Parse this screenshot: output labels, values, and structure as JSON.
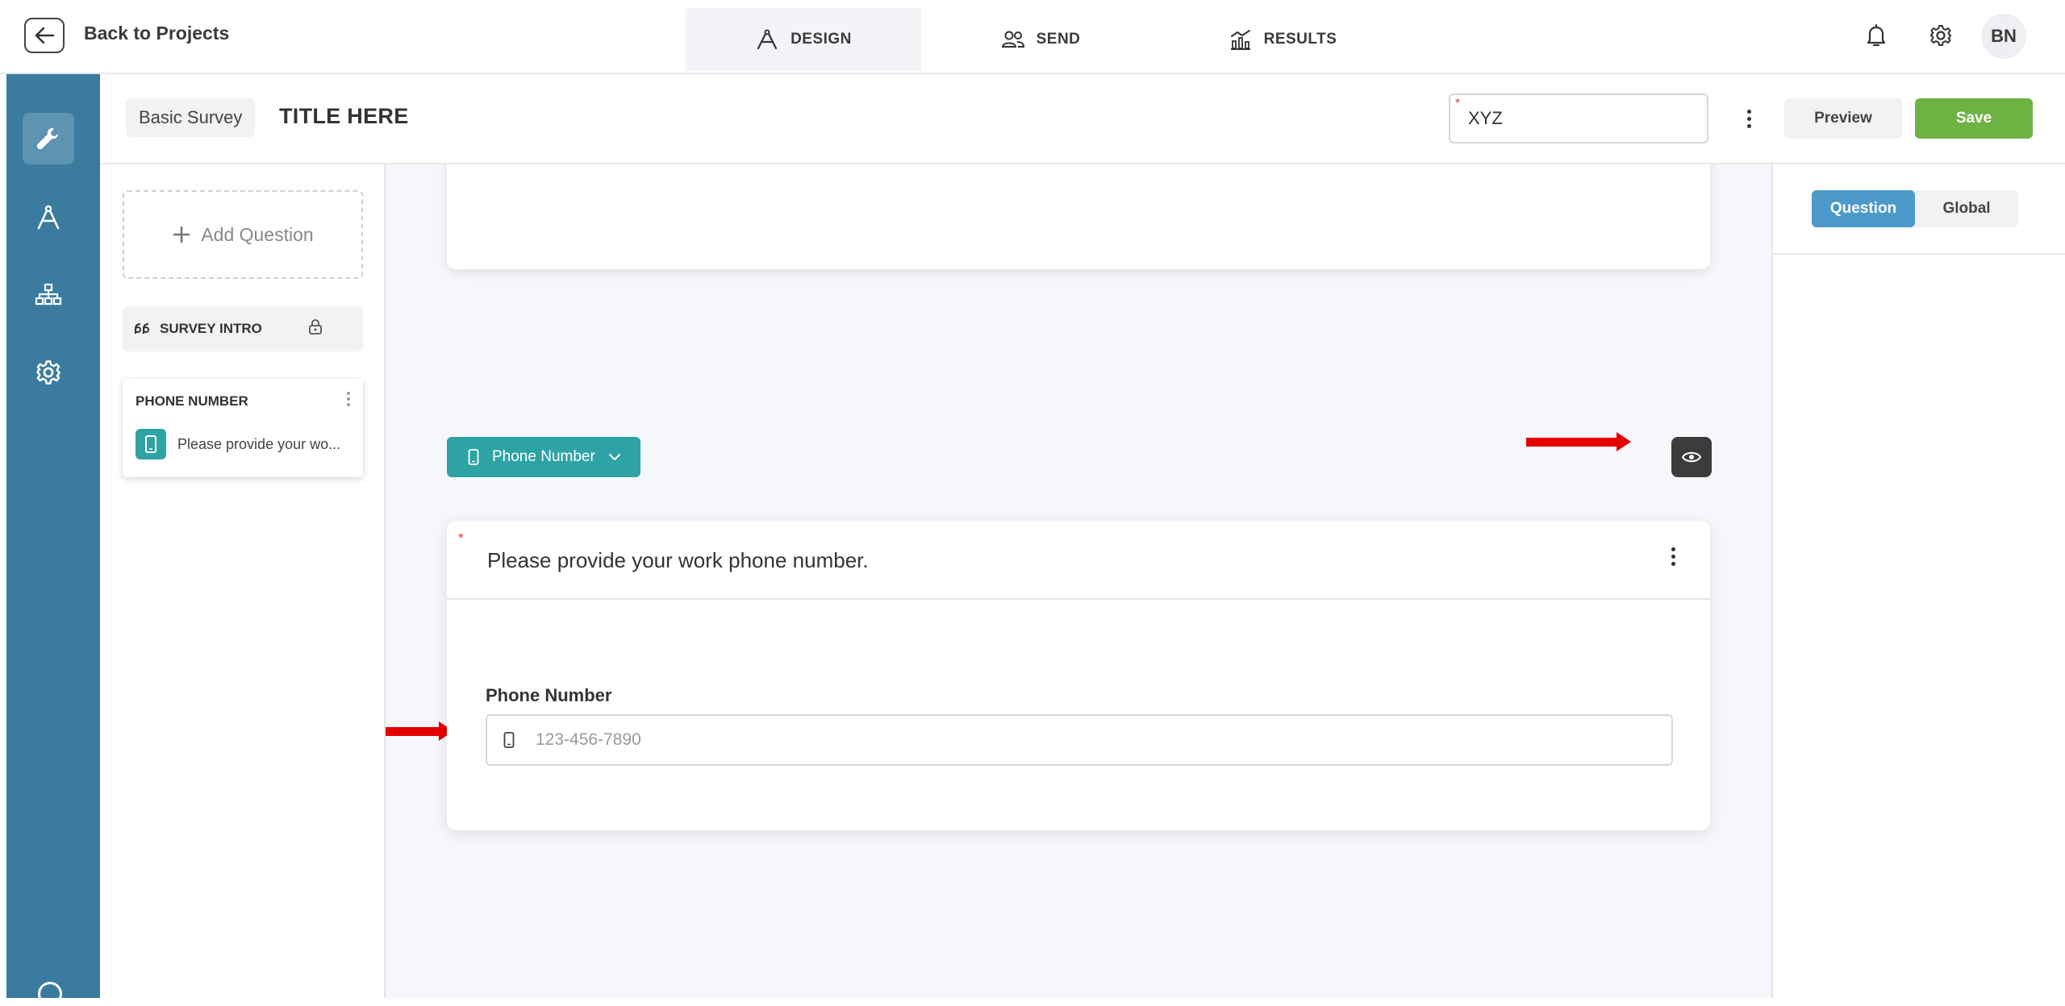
{
  "topbar": {
    "back_label": "Back to Projects",
    "tabs": [
      {
        "label": "DESIGN",
        "icon": "compass-icon",
        "active": true
      },
      {
        "label": "SEND",
        "icon": "people-icon",
        "active": false
      },
      {
        "label": "RESULTS",
        "icon": "chart-icon",
        "active": false
      }
    ],
    "avatar_initials": "BN"
  },
  "rail": {
    "items": [
      "wrench-icon",
      "compass-icon",
      "sitemap-icon",
      "gear-icon"
    ],
    "active_index": 0,
    "color": "#3a7b9f"
  },
  "subheader": {
    "survey_type": "Basic Survey",
    "survey_title": "TITLE HERE",
    "language_value": "XYZ",
    "preview_label": "Preview",
    "save_label": "Save",
    "save_color": "#6fb244"
  },
  "question_panel": {
    "add_question_label": "Add Question",
    "intro_label": "SURVEY INTRO",
    "question_card": {
      "title": "PHONE NUMBER",
      "text": "Please provide your wo..."
    }
  },
  "canvas": {
    "type_dropdown_label": "Phone Number",
    "question_text": "Please provide your work phone number.",
    "field_label": "Phone Number",
    "field_placeholder": "123-456-7890",
    "accent_color": "#2ea3a5",
    "annotation_arrow_color": "#e50000"
  },
  "properties_panel": {
    "tabs": [
      {
        "label": "Question",
        "active": true
      },
      {
        "label": "Global",
        "active": false
      }
    ]
  }
}
